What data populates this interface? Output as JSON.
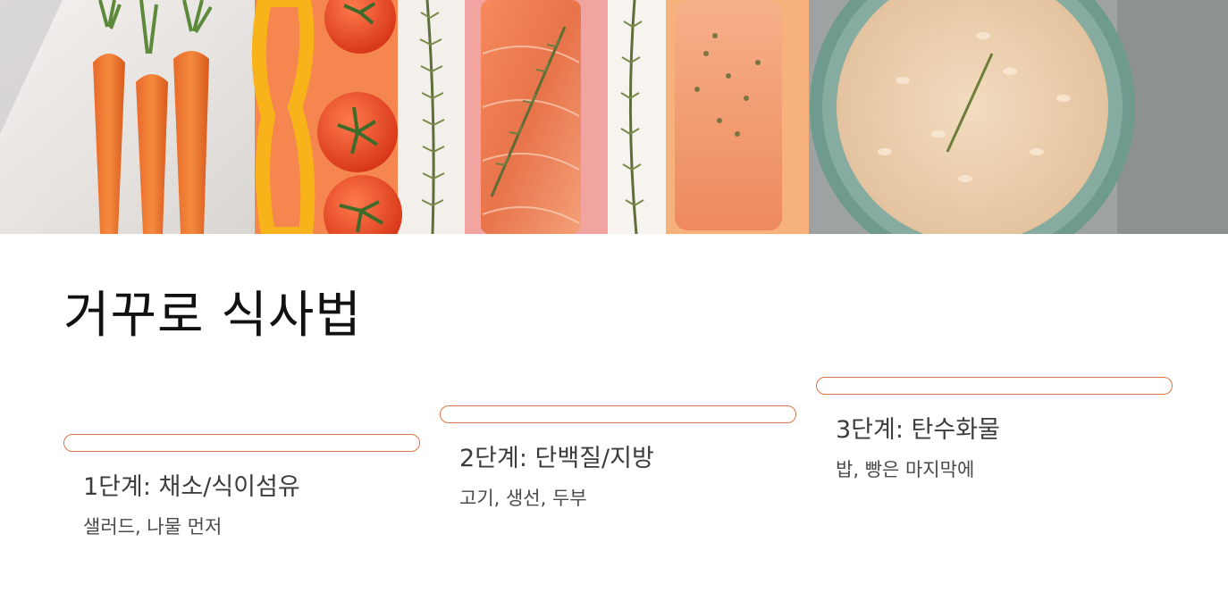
{
  "title": "거꾸로 식사법",
  "hero_image": {
    "depicts": [
      "carrot",
      "yellow-pepper",
      "tomato",
      "rosemary",
      "salmon",
      "rice-bowl"
    ]
  },
  "accent_color": "#d9764a",
  "steps": [
    {
      "heading": "1단계: 채소/식이섬유",
      "description": "샐러드, 나물 먼저"
    },
    {
      "heading": "2단계: 단백질/지방",
      "description": "고기, 생선, 두부"
    },
    {
      "heading": "3단계: 탄수화물",
      "description": "밥, 빵은 마지막에"
    }
  ]
}
